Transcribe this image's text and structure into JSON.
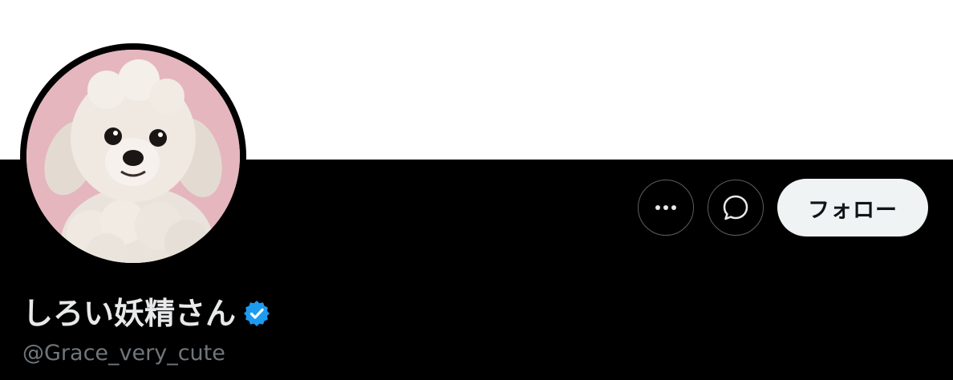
{
  "profile": {
    "display_name": "しろい妖精さん",
    "handle": "@Grace_very_cute",
    "verified": true,
    "verified_icon": "verified-badge-icon",
    "avatar_subject": "white-poodle-dog",
    "avatar_background": "#e5b6bd"
  },
  "actions": {
    "more_icon": "more-horizontal-icon",
    "message_icon": "chat-bubble-icon",
    "follow_label": "フォロー"
  },
  "colors": {
    "banner": "#ffffff",
    "background": "#000000",
    "verified_blue": "#1d9bf0",
    "follow_bg": "#eff3f4"
  }
}
